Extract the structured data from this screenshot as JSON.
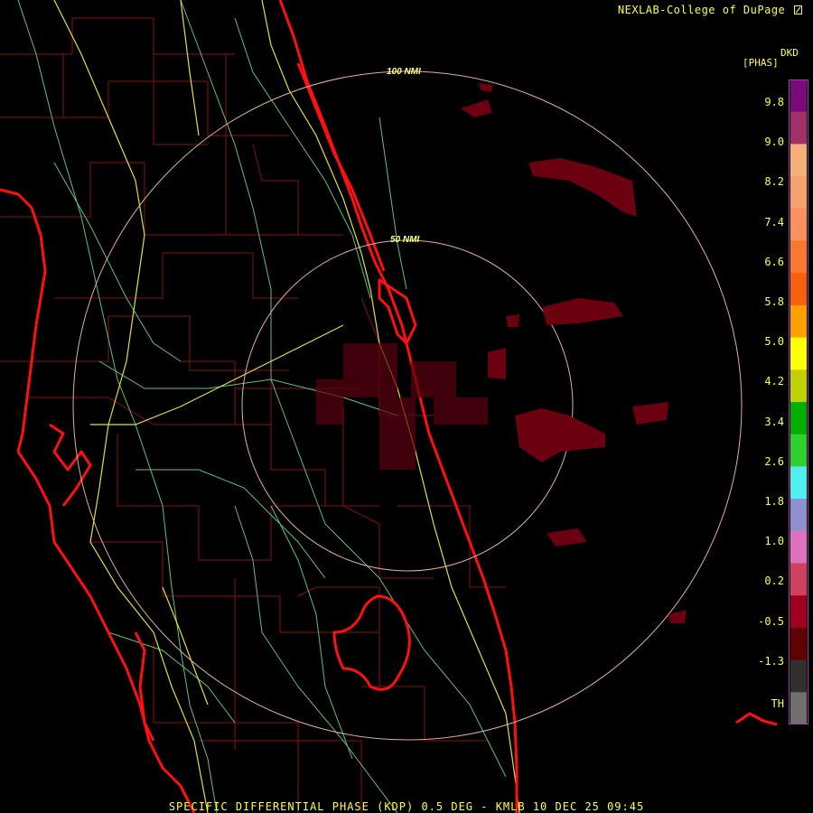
{
  "header": {
    "credit": "NEXLAB-College of DuPage"
  },
  "colorbar": {
    "units_top": "DKD",
    "units_bottom": "[PHAS]",
    "tick_labels": [
      "9.8",
      "9.0",
      "8.2",
      "7.4",
      "6.6",
      "5.8",
      "5.0",
      "4.2",
      "3.4",
      "2.6",
      "1.8",
      "1.0",
      "0.2",
      "-0.5",
      "-1.3",
      "TH"
    ],
    "colors": [
      "#7a0a7a",
      "#a0306a",
      "#f6b07a",
      "#f6a070",
      "#f89060",
      "#f87830",
      "#f86010",
      "#fca000",
      "#ffff00",
      "#c0d000",
      "#00b000",
      "#30d030",
      "#50f0f0",
      "#9090d0",
      "#e070c0",
      "#d04060",
      "#a00020",
      "#600000",
      "#303030",
      "#707070"
    ]
  },
  "range_rings": {
    "inner_label": "50 NMI",
    "outer_label": "100 NMI"
  },
  "footer": {
    "product_line": "SPECIFIC DIFFERENTIAL PHASE (KDP) 0.5 DEG - KMLB 10 DEC 25 09:45"
  }
}
